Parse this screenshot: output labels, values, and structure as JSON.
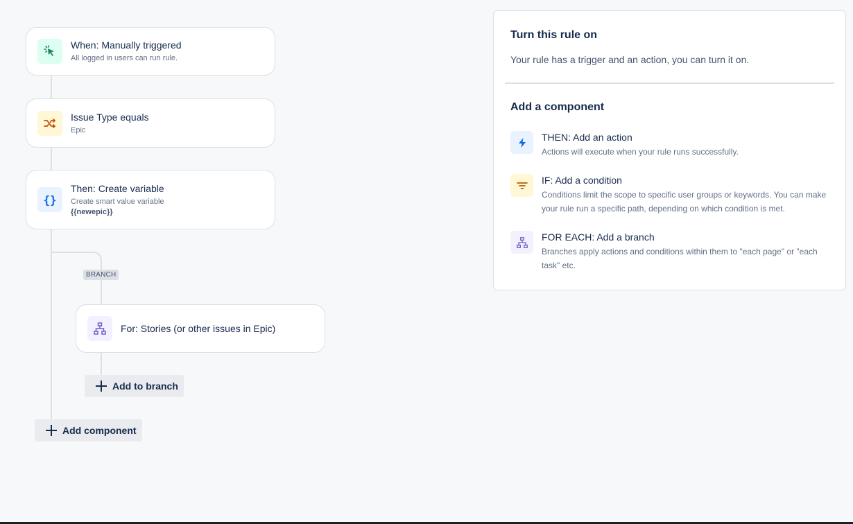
{
  "flow": {
    "trigger": {
      "title": "When: Manually triggered",
      "subtitle": "All logged in users can run rule."
    },
    "condition": {
      "title": "Issue Type equals",
      "subtitle": "Epic"
    },
    "action": {
      "title": "Then: Create variable",
      "subtitle": "Create smart value variable",
      "value": "{{newepic}}"
    },
    "branch_label": "BRANCH",
    "branch": {
      "title": "For: Stories (or other issues in Epic)"
    },
    "add_to_branch_label": "Add to branch",
    "add_component_label": "Add component"
  },
  "panel": {
    "heading": "Turn this rule on",
    "description": "Your rule has a trigger and an action, you can turn it on.",
    "add_heading": "Add a component",
    "components": [
      {
        "title": "THEN: Add an action",
        "description": "Actions will execute when your rule runs successfully.",
        "icon": "lightning-icon"
      },
      {
        "title": "IF: Add a condition",
        "description": "Conditions limit the scope to specific user groups or keywords. You can make your rule run a specific path, depending on which condition is met.",
        "icon": "filter-icon"
      },
      {
        "title": "FOR EACH: Add a branch",
        "description": "Branches apply actions and conditions within them to \"each page\" or \"each task\" etc.",
        "icon": "branch-icon"
      }
    ]
  },
  "colors": {
    "trigger_icon": "#1f845a",
    "condition_icon": "#c25100",
    "action_icon": "#0c66e4",
    "branch_icon": "#6e5dc6",
    "filter_icon": "#b65c02"
  }
}
